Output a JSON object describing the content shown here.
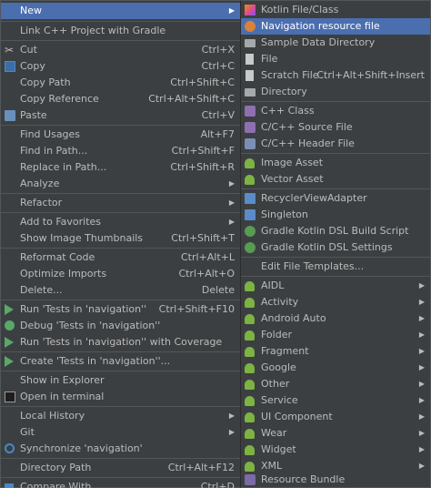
{
  "left": {
    "items": [
      {
        "label": "New",
        "shortcut": "",
        "submenu": true,
        "selected": true,
        "icon": ""
      },
      {
        "label": "Link C++ Project with Gradle",
        "shortcut": "",
        "submenu": false,
        "icon": ""
      },
      {
        "label": "Cut",
        "shortcut": "Ctrl+X",
        "icon": "cut-icon"
      },
      {
        "label": "Copy",
        "shortcut": "Ctrl+C",
        "icon": "copy-icon"
      },
      {
        "label": "Copy Path",
        "shortcut": "Ctrl+Shift+C",
        "icon": ""
      },
      {
        "label": "Copy Reference",
        "shortcut": "Ctrl+Alt+Shift+C",
        "icon": ""
      },
      {
        "label": "Paste",
        "shortcut": "Ctrl+V",
        "icon": "paste-icon"
      },
      {
        "label": "Find Usages",
        "shortcut": "Alt+F7",
        "icon": ""
      },
      {
        "label": "Find in Path...",
        "shortcut": "Ctrl+Shift+F",
        "icon": ""
      },
      {
        "label": "Replace in Path...",
        "shortcut": "Ctrl+Shift+R",
        "icon": ""
      },
      {
        "label": "Analyze",
        "shortcut": "",
        "submenu": true,
        "icon": ""
      },
      {
        "label": "Refactor",
        "shortcut": "",
        "submenu": true,
        "icon": ""
      },
      {
        "label": "Add to Favorites",
        "shortcut": "",
        "submenu": true,
        "icon": ""
      },
      {
        "label": "Show Image Thumbnails",
        "shortcut": "Ctrl+Shift+T",
        "icon": ""
      },
      {
        "label": "Reformat Code",
        "shortcut": "Ctrl+Alt+L",
        "icon": ""
      },
      {
        "label": "Optimize Imports",
        "shortcut": "Ctrl+Alt+O",
        "icon": ""
      },
      {
        "label": "Delete...",
        "shortcut": "Delete",
        "icon": ""
      },
      {
        "label": "Run 'Tests in 'navigation''",
        "shortcut": "Ctrl+Shift+F10",
        "icon": "run-icon"
      },
      {
        "label": "Debug 'Tests in 'navigation''",
        "shortcut": "",
        "icon": "debug-icon"
      },
      {
        "label": "Run 'Tests in 'navigation'' with Coverage",
        "shortcut": "",
        "icon": "coverage-icon"
      },
      {
        "label": "Create 'Tests in 'navigation''...",
        "shortcut": "",
        "icon": "create-test-icon"
      },
      {
        "label": "Show in Explorer",
        "shortcut": "",
        "icon": ""
      },
      {
        "label": "Open in terminal",
        "shortcut": "",
        "icon": "terminal-icon"
      },
      {
        "label": "Local History",
        "shortcut": "",
        "submenu": true,
        "icon": ""
      },
      {
        "label": "Git",
        "shortcut": "",
        "submenu": true,
        "icon": ""
      },
      {
        "label": "Synchronize 'navigation'",
        "shortcut": "",
        "icon": "sync-icon"
      },
      {
        "label": "Directory Path",
        "shortcut": "Ctrl+Alt+F12",
        "icon": ""
      },
      {
        "label": "Compare With...",
        "shortcut": "Ctrl+D",
        "icon": "compare-icon"
      }
    ]
  },
  "right": {
    "items": [
      {
        "label": "Kotlin File/Class",
        "icon": "kotlin-icon"
      },
      {
        "label": "Navigation resource file",
        "selected": true,
        "icon": "navigation-icon"
      },
      {
        "label": "Sample Data Directory",
        "icon": "folder-icon"
      },
      {
        "label": "File",
        "icon": "file-icon"
      },
      {
        "label": "Scratch File",
        "shortcut": "Ctrl+Alt+Shift+Insert",
        "icon": "scratch-icon"
      },
      {
        "label": "Directory",
        "icon": "folder-icon"
      },
      {
        "label": "C++ Class",
        "icon": "cpp-icon"
      },
      {
        "label": "C/C++ Source File",
        "icon": "cpp-source-icon"
      },
      {
        "label": "C/C++ Header File",
        "icon": "header-icon"
      },
      {
        "label": "Image Asset",
        "icon": "android-icon"
      },
      {
        "label": "Vector Asset",
        "icon": "android-icon"
      },
      {
        "label": "RecyclerViewAdapter",
        "icon": "recycler-icon"
      },
      {
        "label": "Singleton",
        "icon": "singleton-icon"
      },
      {
        "label": "Gradle Kotlin DSL Build Script",
        "icon": "gradle-icon"
      },
      {
        "label": "Gradle Kotlin DSL Settings",
        "icon": "gradle-icon"
      },
      {
        "label": "Edit File Templates...",
        "icon": ""
      },
      {
        "label": "AIDL",
        "submenu": true,
        "icon": "android-icon"
      },
      {
        "label": "Activity",
        "submenu": true,
        "icon": "android-icon"
      },
      {
        "label": "Android Auto",
        "submenu": true,
        "icon": "android-icon"
      },
      {
        "label": "Folder",
        "submenu": true,
        "icon": "android-icon"
      },
      {
        "label": "Fragment",
        "submenu": true,
        "icon": "android-icon"
      },
      {
        "label": "Google",
        "submenu": true,
        "icon": "android-icon"
      },
      {
        "label": "Other",
        "submenu": true,
        "icon": "android-icon"
      },
      {
        "label": "Service",
        "submenu": true,
        "icon": "android-icon"
      },
      {
        "label": "UI Component",
        "submenu": true,
        "icon": "android-icon"
      },
      {
        "label": "Wear",
        "submenu": true,
        "icon": "android-icon"
      },
      {
        "label": "Widget",
        "submenu": true,
        "icon": "android-icon"
      },
      {
        "label": "XML",
        "submenu": true,
        "icon": "android-icon"
      },
      {
        "label": "Resource Bundle",
        "icon": "bundle-icon"
      }
    ]
  },
  "arrow_glyph": "▶",
  "colors": {
    "selection": "#4b6eaf",
    "background": "#3c3f41",
    "text": "#bbbbbb"
  }
}
